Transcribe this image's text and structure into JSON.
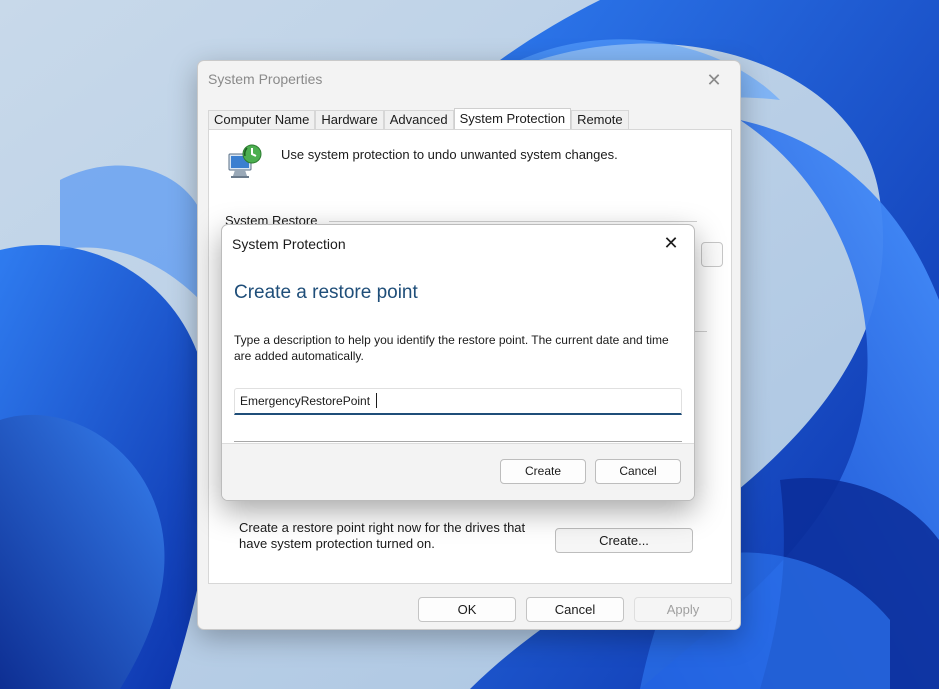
{
  "system_properties": {
    "title": "System Properties",
    "close_glyph": "✕",
    "tabs": [
      {
        "label": "Computer Name",
        "active": false
      },
      {
        "label": "Hardware",
        "active": false
      },
      {
        "label": "Advanced",
        "active": false
      },
      {
        "label": "System Protection",
        "active": true
      },
      {
        "label": "Remote",
        "active": false
      }
    ],
    "intro_text": "Use system protection to undo unwanted system changes.",
    "intro_icon": "system-protection-icon",
    "group_label": "System Restore",
    "create_description": "Create a restore point right now for the drives that have system protection turned on.",
    "create_button_label": "Create...",
    "footer": {
      "ok_label": "OK",
      "cancel_label": "Cancel",
      "apply_label": "Apply"
    }
  },
  "dialog": {
    "title": "System Protection",
    "close_glyph": "✕",
    "heading": "Create a restore point",
    "description": "Type a description to help you identify the restore point. The current date and time are added automatically.",
    "input_value": "EmergencyRestorePoint",
    "create_label": "Create",
    "cancel_label": "Cancel"
  },
  "colors": {
    "heading_blue": "#1f4e79",
    "input_focus": "#1f4e79",
    "wallpaper_blue": "#1e5ee8"
  }
}
